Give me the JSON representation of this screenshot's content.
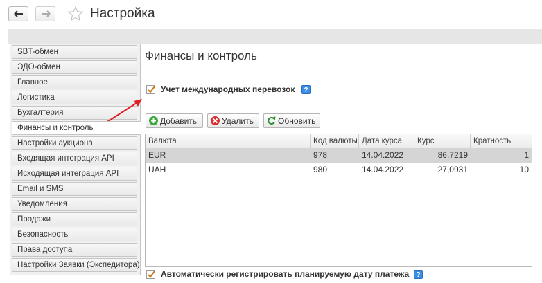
{
  "window": {
    "title": "Настройка"
  },
  "sidebar": {
    "items": [
      {
        "label": "SBT-обмен"
      },
      {
        "label": "ЭДО-обмен"
      },
      {
        "label": "Главное"
      },
      {
        "label": "Логистика"
      },
      {
        "label": "Бухгалтерия"
      },
      {
        "label": "Финансы и контроль",
        "active": true
      },
      {
        "label": "Настройки аукциона"
      },
      {
        "label": "Входящая интеграция API"
      },
      {
        "label": "Исходящая интеграция API"
      },
      {
        "label": "Email и SMS"
      },
      {
        "label": "Уведомления"
      },
      {
        "label": "Продажи"
      },
      {
        "label": "Безопасность"
      },
      {
        "label": "Права доступа"
      },
      {
        "label": "Настройки Заявки (Экспедитора)"
      }
    ]
  },
  "main": {
    "heading": "Финансы и контроль",
    "intl_transport": {
      "label": "Учет международных перевозок",
      "checked": true,
      "help": "?"
    },
    "toolbar": {
      "add": "Добавить",
      "delete": "Удалить",
      "refresh": "Обновить"
    },
    "table": {
      "columns": [
        "Валюта",
        "Код валюты",
        "Дата курса",
        "Курс",
        "Кратность"
      ],
      "rows": [
        {
          "currency": "EUR",
          "code": "978",
          "date": "14.04.2022",
          "rate": "86,7219",
          "multiplicity": "1",
          "selected": true
        },
        {
          "currency": "UAH",
          "code": "980",
          "date": "14.04.2022",
          "rate": "27,0931",
          "multiplicity": "10",
          "selected": false
        }
      ]
    },
    "auto_payment": {
      "label": "Автоматически регистрировать планируемую дату платежа",
      "checked": true,
      "help": "?"
    }
  },
  "colors": {
    "accent": "#3a8ee6",
    "checkmark": "#c77a18",
    "annotation": "#e02020",
    "add": "#3aa83a",
    "delete": "#d83030",
    "refresh": "#2f8f2f"
  }
}
